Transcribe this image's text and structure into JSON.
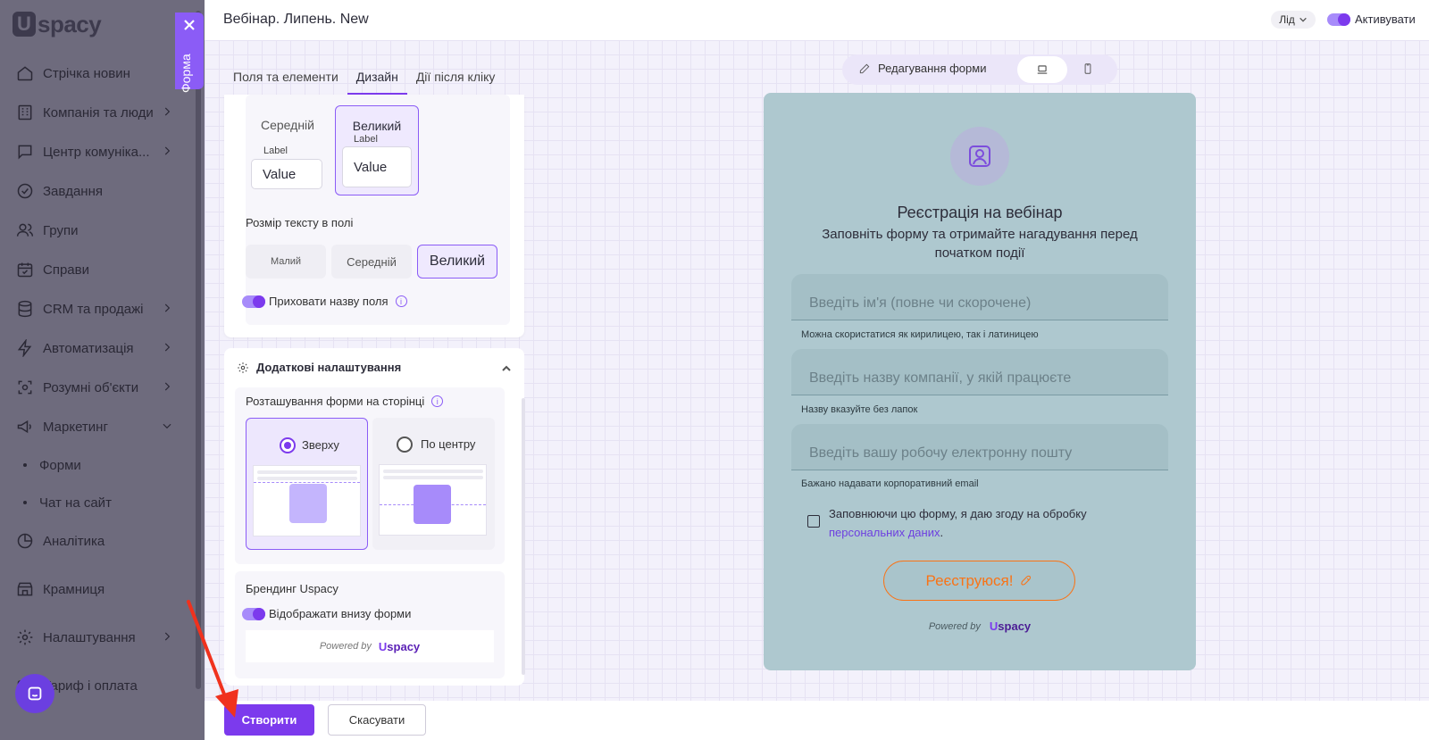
{
  "brand": {
    "logo_u": "U",
    "logo_text": "spacy"
  },
  "sidebar": {
    "items": [
      {
        "label": "Стрічка новин",
        "icon": "home-icon",
        "chevron": false
      },
      {
        "label": "Компанія та люди",
        "icon": "company-icon",
        "chevron": true
      },
      {
        "label": "Центр комуніка...",
        "icon": "chat-icon",
        "chevron": true
      },
      {
        "label": "Завдання",
        "icon": "check-circle-icon",
        "chevron": false
      },
      {
        "label": "Групи",
        "icon": "users-icon",
        "chevron": false
      },
      {
        "label": "Справи",
        "icon": "calendar-icon",
        "chevron": false
      },
      {
        "label": "CRM та продажі",
        "icon": "database-icon",
        "chevron": true
      },
      {
        "label": "Автоматизація",
        "icon": "bolt-icon",
        "chevron": true
      },
      {
        "label": "Розумні об'єкти",
        "icon": "smart-object-icon",
        "chevron": true
      },
      {
        "label": "Маркетинг",
        "icon": "megaphone-icon",
        "chevron": true
      }
    ],
    "sub_items": [
      "Форми",
      "Чат на сайт"
    ],
    "bottom_items": [
      {
        "label": "Аналітика",
        "icon": "chart-icon"
      },
      {
        "label": "Крамниця",
        "icon": "store-icon"
      },
      {
        "label": "Налаштування",
        "icon": "gear-icon"
      },
      {
        "label": "Тариф і оплата",
        "icon": "card-icon"
      }
    ]
  },
  "form_tab": {
    "label": "Форма"
  },
  "header": {
    "title": "Вебінар. Липень. New",
    "entity_type": "Лід",
    "activate_label": "Активувати"
  },
  "tabs": [
    "Поля та елементи",
    "Дизайн",
    "Дії після кліку"
  ],
  "field_size": {
    "options": [
      {
        "name": "Середній",
        "label": "Label",
        "value": "Value"
      },
      {
        "name": "Великий",
        "label": "Label",
        "value": "Value"
      }
    ],
    "selected": "Великий"
  },
  "text_size": {
    "title": "Розмір тексту в полі",
    "options": [
      "Малий",
      "Середній",
      "Великий"
    ],
    "selected": "Великий"
  },
  "hide_field_name": {
    "label": "Приховати назву поля",
    "enabled": true
  },
  "additional": {
    "title": "Додаткові налаштування",
    "position_title": "Розташування форми на сторінці",
    "positions": [
      "Зверху",
      "По центру"
    ],
    "selected_position": "Зверху",
    "branding_title": "Брендинг Uspacy",
    "branding_toggle": "Відображати внизу форми",
    "branding_enabled": true,
    "powered_by": "Powered by"
  },
  "view_bar": {
    "edit_label": "Редагування форми"
  },
  "form_preview": {
    "title": "Реєстрація на вебінар",
    "subtitle": "Заповніть форму та отримайте нагадування перед початком події",
    "fields": [
      {
        "placeholder": "Введіть ім'я (повне чи скорочене)",
        "hint": "Можна скористатися як кирилицею, так і латиницею"
      },
      {
        "placeholder": "Введіть назву компанії, у якій працюєте",
        "hint": "Назву вказуйте без лапок"
      },
      {
        "placeholder": "Введіть вашу робочу електронну пошту",
        "hint": "Бажано надавати корпоративний email"
      }
    ],
    "consent_text": "Заповнюючи цю форму, я даю згоду на обробку",
    "consent_link": "персональних даних",
    "consent_end": ".",
    "submit_label": "Реєструюся!",
    "powered_by": "Powered by"
  },
  "footer": {
    "create_label": "Створити",
    "cancel_label": "Скасувати"
  },
  "colors": {
    "accent": "#7c3aed",
    "submit": "#f97316",
    "form_bg": "#aec8cf"
  }
}
